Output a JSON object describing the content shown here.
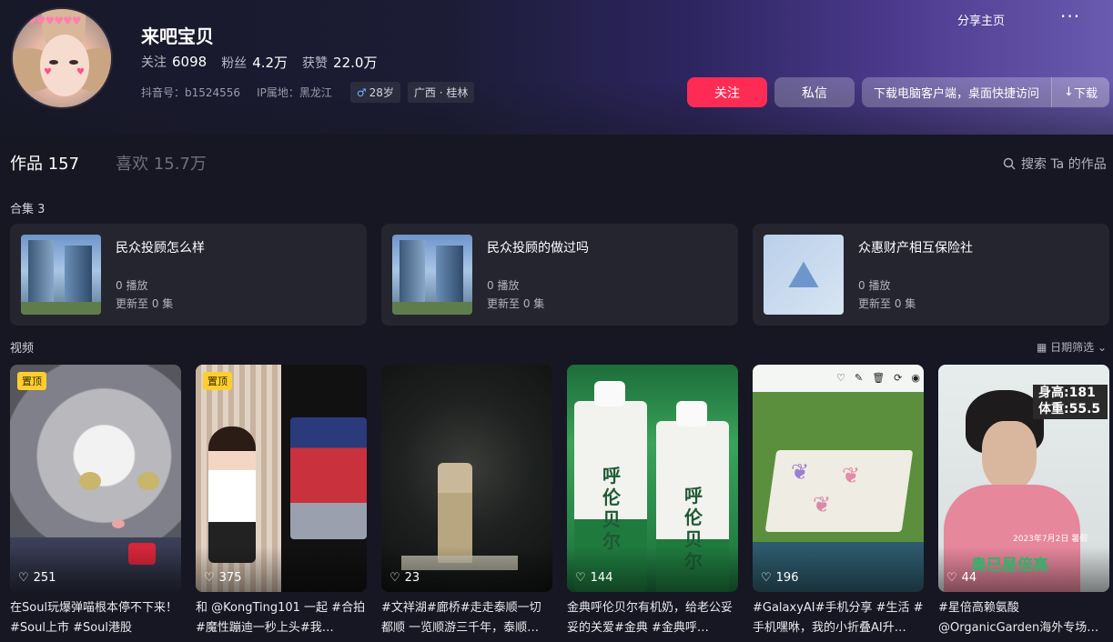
{
  "profile": {
    "name": "来吧宝贝",
    "stats": [
      {
        "label": "关注",
        "value": "6098"
      },
      {
        "label": "粉丝",
        "value": "4.2万"
      },
      {
        "label": "获赞",
        "value": "22.0万"
      }
    ],
    "douyin_id": "抖音号：b1524556",
    "ip": "IP属地：黑龙江",
    "age_tag": "28岁",
    "location_tag": "广西 · 桂林"
  },
  "header": {
    "share_home": "分享主页",
    "more": "···",
    "follow": "关注",
    "message": "私信",
    "download_text": "下载电脑客户端，桌面快捷访问",
    "download_btn": "下载"
  },
  "tabs": {
    "works": "作品 157",
    "likes": "喜欢 15.7万",
    "search": "搜索 Ta 的作品"
  },
  "collections": {
    "label": "合集 3",
    "items": [
      {
        "title": "民众投顾怎么样",
        "plays": "0 播放",
        "updated": "更新至 0 集"
      },
      {
        "title": "民众投顾的做过吗",
        "plays": "0 播放",
        "updated": "更新至 0 集"
      },
      {
        "title": "众惠财产相互保险社",
        "plays": "0 播放",
        "updated": "更新至 0 集"
      }
    ]
  },
  "videos": {
    "label": "视频",
    "date_filter": "日期筛选",
    "pin_label": "置顶",
    "items": [
      {
        "likes": "251",
        "desc": "在Soul玩爆弹喵根本停不下来！#Soul上市 #Soul港股"
      },
      {
        "likes": "375",
        "desc": "和 @KongTing101 一起 #合拍 #魔性蹦迪一秒上头#我…"
      },
      {
        "likes": "23",
        "desc": "#文祥湖#廊桥#走走泰顺一切都顺 一览顺游三千年，泰顺…"
      },
      {
        "likes": "144",
        "desc": "金典呼伦贝尔有机奶，给老公妥妥的关爱#金典 #金典呼…"
      },
      {
        "likes": "196",
        "desc": "#GalaxyAI#手机分享 #生活 #手机嘿咻，我的小折叠AI升…"
      },
      {
        "likes": "44",
        "desc": "#星倍高赖氨酸 @OrganicGarden海外专场…"
      }
    ],
    "thumb_text": {
      "milk_brand": "呼伦贝尔",
      "height_weight": "身高:181 体重:55.5",
      "caption": "奥已星倍高",
      "date": "2023年7月2日 暑假"
    }
  },
  "colors": {
    "follow": "#fe2c55",
    "background": "#161722",
    "pin": "#fece2f"
  }
}
